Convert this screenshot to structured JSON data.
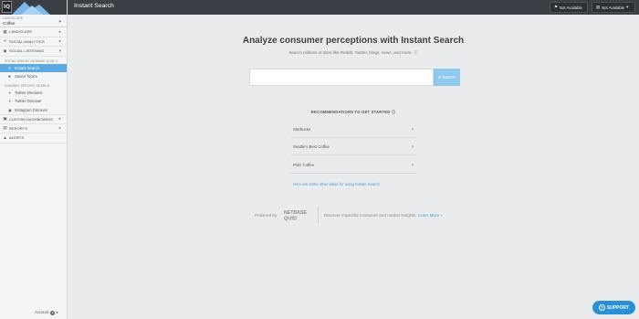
{
  "brand": {
    "logo_text": "IQ"
  },
  "context": {
    "label": "LANDSCAPE",
    "value": "Coffee"
  },
  "sidebar": {
    "sections": [
      {
        "label": "LANDSCAPE",
        "icon": "grid-icon"
      },
      {
        "label": "SOCIAL ANALYTICS",
        "icon": "share-icon"
      },
      {
        "label": "SOCIAL LISTENING",
        "icon": "chat-icon"
      }
    ],
    "listening_head": "SOCIAL WEB BY NETBASE QUID ⓘ",
    "listening_items": [
      {
        "label": "Instant Search",
        "icon": "search-icon",
        "active": true
      },
      {
        "label": "Saved Topics",
        "icon": "bookmark-icon"
      }
    ],
    "channel_head": "CHANNEL SPECIFIC SEARCH",
    "channel_items": [
      {
        "label": "Twitter Mentions",
        "icon": "twitter-icon"
      },
      {
        "label": "Twitter Discover",
        "icon": "twitter-icon"
      },
      {
        "label": "Instagram Discover",
        "icon": "instagram-icon"
      }
    ],
    "bottom_sections": [
      {
        "label": "CUSTOM DASHBOARDS",
        "icon": "dashboard-icon"
      },
      {
        "label": "REPORTS",
        "icon": "report-icon"
      },
      {
        "label": "ALERTS",
        "icon": "bell-icon"
      }
    ],
    "account_label": "Account"
  },
  "topbar": {
    "title": "Instant Search",
    "button_a": "Not Available",
    "button_b": "Not Available"
  },
  "main": {
    "headline": "Analyze consumer perceptions with Instant Search",
    "subtext": "Search millions of sites like Reddit, Twitter, blogs, news, and more. ⓘ",
    "search_placeholder": "",
    "search_button": "Search",
    "rec_title": "RECOMMENDATIONS TO GET STARTED ⓘ",
    "recommendations": [
      "Starbucks",
      "Seattle's Best Coffee",
      "Philz Coffee"
    ],
    "rec_link": "Here are some other ideas for using Instant Search",
    "powered_by": "Powered by",
    "nq_logo_text": "NETBASE QUID",
    "discover_text": "Discover impactful consumer and market insights.",
    "learn_more": "Learn More »"
  },
  "support": {
    "label": "SUPPORT"
  },
  "colors": {
    "accent": "#5aa9e0",
    "topbar": "#3b3f45",
    "support": "#2b8fd6"
  }
}
